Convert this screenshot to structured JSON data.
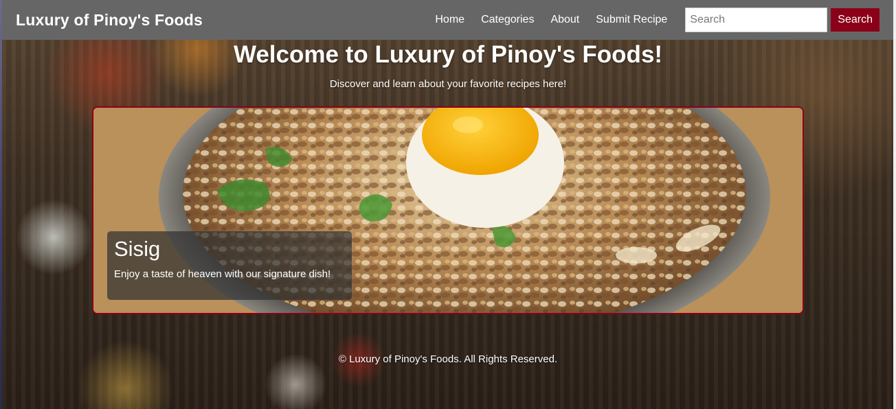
{
  "navbar": {
    "brand": "Luxury of Pinoy's Foods",
    "links": [
      "Home",
      "Categories",
      "About",
      "Submit Recipe"
    ],
    "search": {
      "placeholder": "Search",
      "value": "",
      "button_label": "Search"
    }
  },
  "hero": {
    "title": "Welcome to Luxury of Pinoy's Foods!",
    "subtitle": "Discover and learn about your favorite recipes here!"
  },
  "featured": {
    "title": "Sisig",
    "description": "Enjoy a taste of heaven with our signature dish!"
  },
  "footer": {
    "text": "© Luxury of Pinoy's Foods. All Rights Reserved."
  },
  "colors": {
    "navbar_bg": "#666666",
    "accent": "#8b0018",
    "text": "#ffffff"
  }
}
